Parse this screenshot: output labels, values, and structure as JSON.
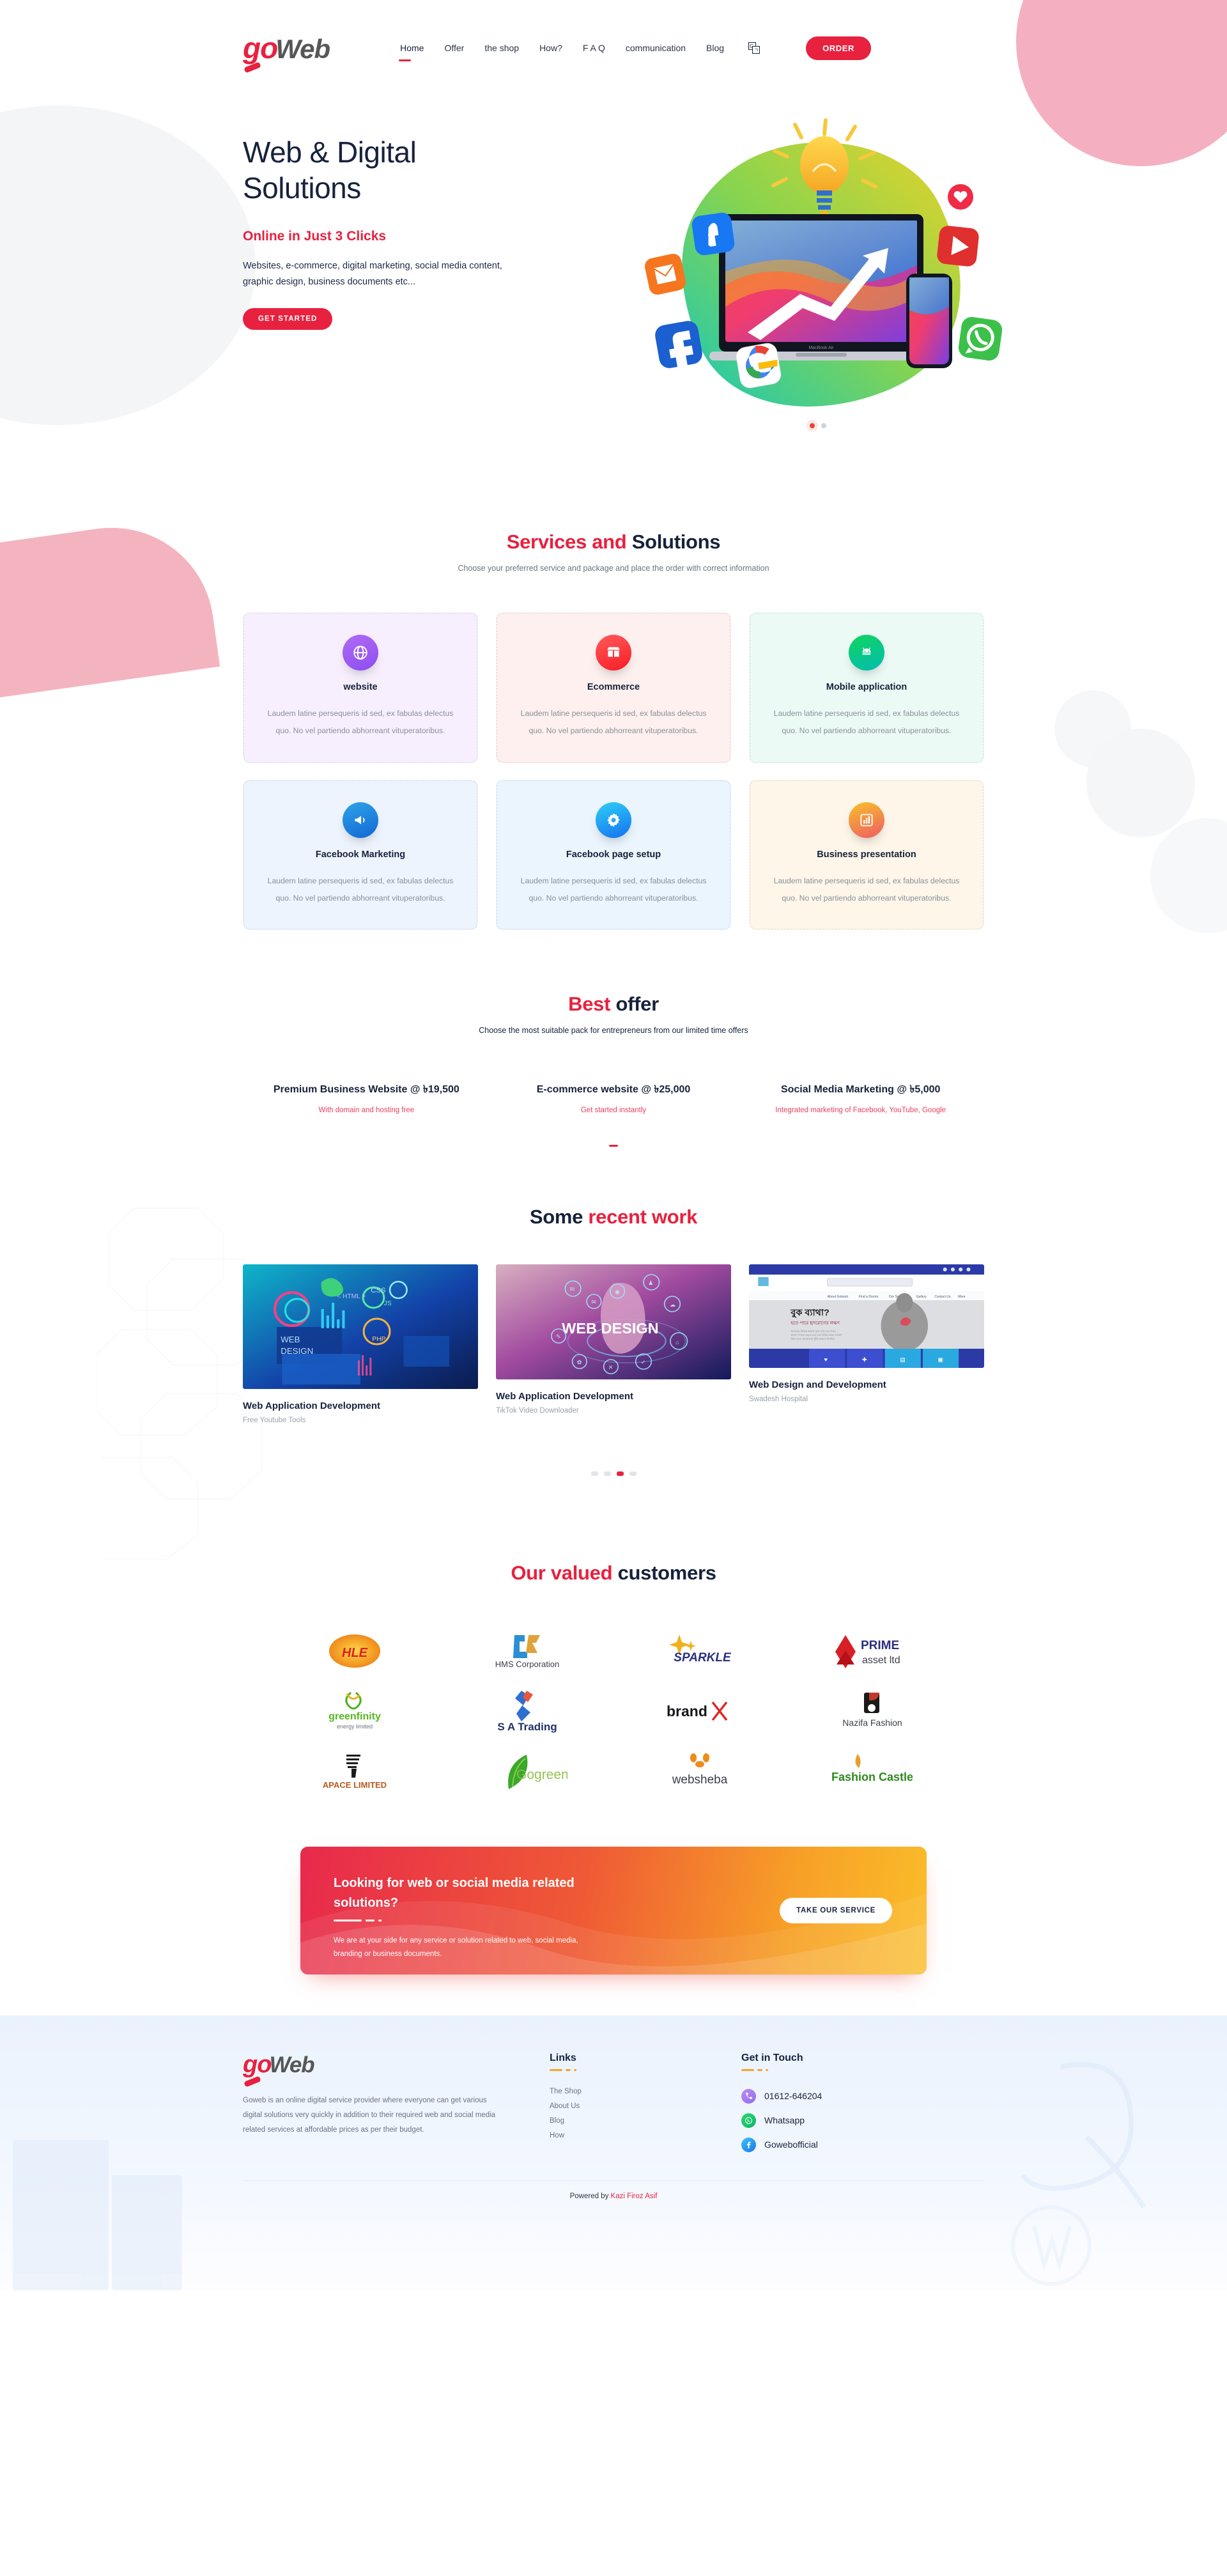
{
  "brand": {
    "go": "go",
    "web": "Web"
  },
  "colors": {
    "red": "#e8213f",
    "navy": "#17223b",
    "grey": "#6b7280",
    "orange": "#f5a623"
  },
  "header": {
    "nav": [
      {
        "label": "Home",
        "active": true
      },
      {
        "label": "Offer",
        "active": false
      },
      {
        "label": "the shop",
        "active": false
      },
      {
        "label": "How?",
        "active": false
      },
      {
        "label": "F A Q",
        "active": false
      },
      {
        "label": "communication",
        "active": false
      },
      {
        "label": "Blog",
        "active": false
      }
    ],
    "language_icon": "translate-icon",
    "order_label": "ORDER"
  },
  "hero": {
    "title_line1": "Web & Digital",
    "title_line2": "Solutions",
    "subtitle": "Online in Just 3 Clicks",
    "description": "Websites, e-commerce, digital marketing, social media content, graphic design, business documents etc...",
    "cta_label": "GET STARTED",
    "illustration": "laptop-phone-social-media-illustration",
    "dots": [
      {
        "active": true
      },
      {
        "active": false
      }
    ]
  },
  "services": {
    "title_red": "Services and ",
    "title_dark": "Solutions",
    "subtitle": "Choose your preferred service and package and place the order with correct information",
    "body_text": "Laudem latine persequeris id sed, ex fabulas delectus quo. No vel partiendo abhorreant vituperatoribus.",
    "cards": [
      {
        "title": "website",
        "icon": "globe-icon",
        "bg": "#f7effd",
        "c1": "#b06bf5",
        "c2": "#8d4ef0"
      },
      {
        "title": "Ecommerce",
        "icon": "shop-icon",
        "bg": "#fdf0ee",
        "c1": "#ff5b5b",
        "c2": "#f81c25"
      },
      {
        "title": "Mobile application",
        "icon": "android-icon",
        "bg": "#ecfaf5",
        "c1": "#13d45f",
        "c2": "#00bdb0"
      },
      {
        "title": "Facebook Marketing",
        "icon": "megaphone-icon",
        "bg": "#eef4fd",
        "c1": "#2fa3e8",
        "c2": "#1268d4"
      },
      {
        "title": "Facebook page setup",
        "icon": "gear-icon",
        "bg": "#eaf5fd",
        "c1": "#2fd0f5",
        "c2": "#1470f0"
      },
      {
        "title": "Business presentation",
        "icon": "bar-chart-icon",
        "bg": "#fdf6e9",
        "c1": "#f7c22a",
        "c2": "#ef5b63"
      }
    ]
  },
  "offer": {
    "title_red": "Best ",
    "title_dark": "offer",
    "subtitle": "Choose the most suitable pack for entrepreneurs from our limited time offers",
    "items": [
      {
        "title": "Premium Business Website @ ৳19,500",
        "note": "With domain and hosting free"
      },
      {
        "title": "E-commerce website @ ৳25,000",
        "note": "Get started instantly"
      },
      {
        "title": "Social Media Marketing @ ৳5,000",
        "note": "Integrated marketing of Facebook, YouTube, Google"
      }
    ]
  },
  "work": {
    "title_dark": "Some ",
    "title_red": "recent work",
    "items": [
      {
        "title": "Web Application Development",
        "sub": "Free Youtube Tools",
        "thumb": "web-design-code-illustration"
      },
      {
        "title": "Web Application Development",
        "sub": "TikTok Video Downloader",
        "thumb": "web-design-touch-illustration"
      },
      {
        "title": "Web Design and Development",
        "sub": "Swadesh Hospital",
        "thumb": "hospital-website-screenshot"
      }
    ],
    "dots": [
      {
        "active": false
      },
      {
        "active": false
      },
      {
        "active": true
      },
      {
        "active": false
      }
    ]
  },
  "customers": {
    "title_red": "Our valued ",
    "title_dark": "customers",
    "logos": [
      {
        "name": "HLE",
        "kind": "hle-logo"
      },
      {
        "name": "HMS Corporation",
        "kind": "hms-logo"
      },
      {
        "name": "SPARKLE",
        "kind": "sparkle-logo"
      },
      {
        "name": "PRIME asset ltd",
        "kind": "prime-logo"
      },
      {
        "name": "greenfinity energy limited",
        "kind": "greenfinity-logo"
      },
      {
        "name": "S A Trading",
        "kind": "satrading-logo"
      },
      {
        "name": "brandx",
        "kind": "brandx-logo"
      },
      {
        "name": "Nazifa Fashion",
        "kind": "nazifa-logo"
      },
      {
        "name": "APACE LIMITED",
        "kind": "apace-logo"
      },
      {
        "name": "Gogreen",
        "kind": "gogreen-logo"
      },
      {
        "name": "websheba",
        "kind": "websheba-logo"
      },
      {
        "name": "Fashion Castle",
        "kind": "fashioncastle-logo"
      }
    ]
  },
  "cta": {
    "title": "Looking for web or social media related solutions?",
    "text": "We are at your side for any service or solution related to web, social media, branding or business documents.",
    "button": "TAKE OUR SERVICE"
  },
  "footer": {
    "about": "Goweb is an online digital service provider where everyone can get various digital solutions very quickly in addition to their required web and social media related services at affordable prices as per their budget.",
    "links_head": "Links",
    "links": [
      {
        "label": "The Shop"
      },
      {
        "label": "About Us"
      },
      {
        "label": "Blog"
      },
      {
        "label": "How"
      }
    ],
    "contact_head": "Get in Touch",
    "contacts": [
      {
        "label": "01612-646204",
        "icon": "phone-icon",
        "c1": "#c08bf5",
        "c2": "#8e6df0"
      },
      {
        "label": "Whatsapp",
        "icon": "whatsapp-icon",
        "c1": "#2bd96a",
        "c2": "#0bb36c"
      },
      {
        "label": "Gowebofficial",
        "icon": "facebook-icon",
        "c1": "#3fc3f5",
        "c2": "#1877f2"
      }
    ],
    "powered_prefix": "Powered by ",
    "powered_name": "Kazi Firoz Asif"
  }
}
